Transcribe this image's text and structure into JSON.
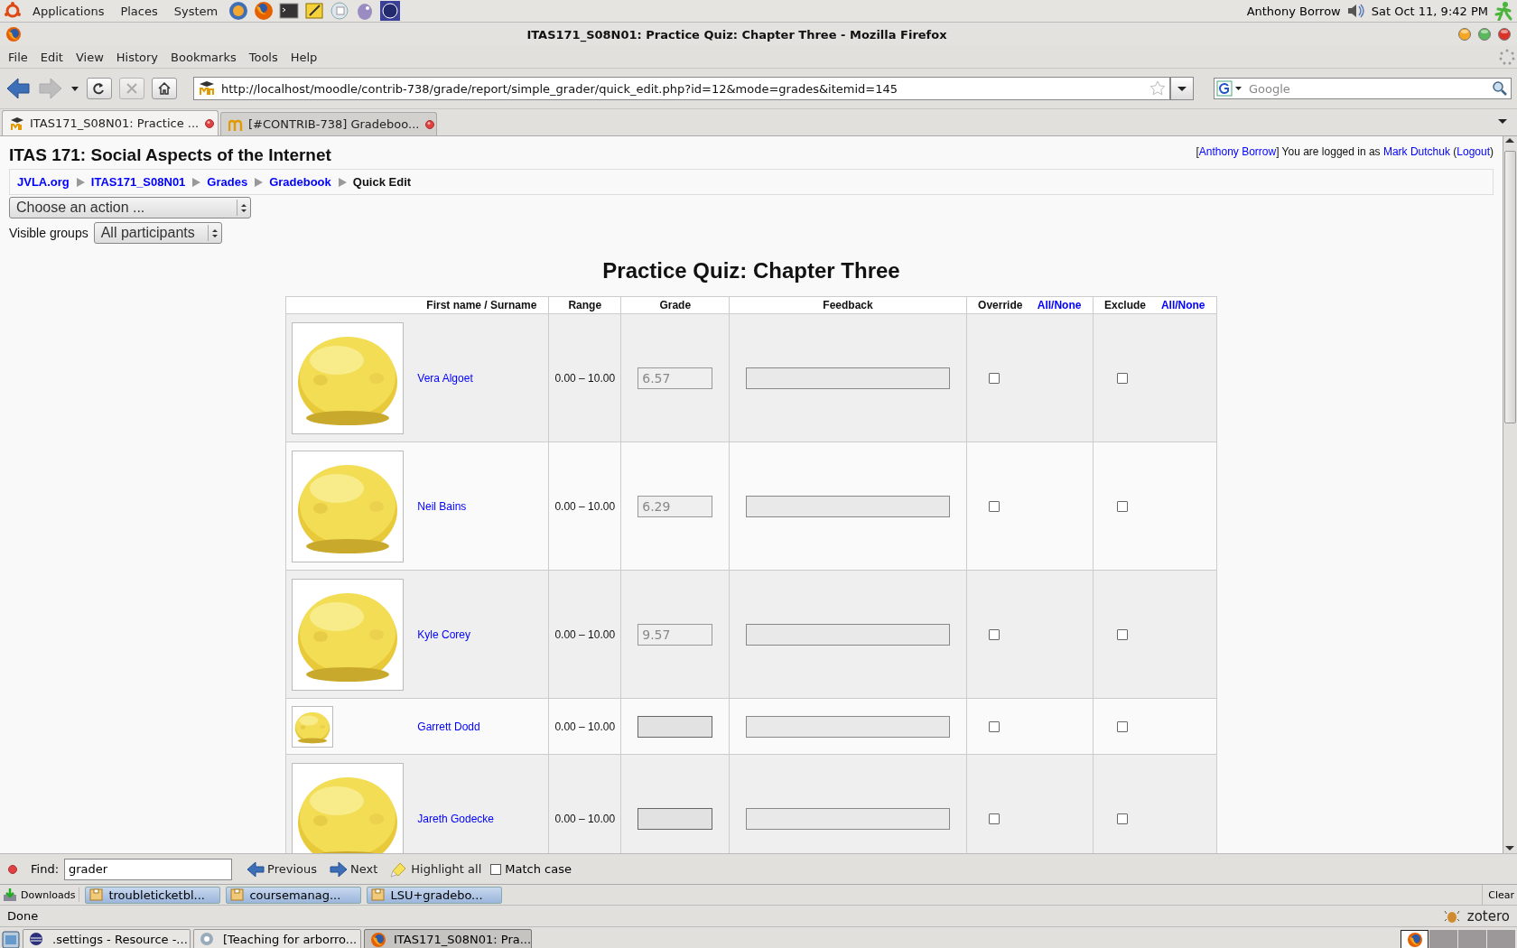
{
  "top_panel": {
    "menus": [
      "Applications",
      "Places",
      "System"
    ],
    "user": "Anthony Borrow",
    "clock": "Sat Oct 11,  9:42 PM"
  },
  "window": {
    "title": "ITAS171_S08N01: Practice Quiz: Chapter Three - Mozilla Firefox"
  },
  "menu_bar": [
    "File",
    "Edit",
    "View",
    "History",
    "Bookmarks",
    "Tools",
    "Help"
  ],
  "toolbar": {
    "url": "http://localhost/moodle/contrib-738/grade/report/simple_grader/quick_edit.php?id=12&mode=grades&itemid=145",
    "search_placeholder": "Google"
  },
  "tabs": [
    {
      "label": "ITAS171_S08N01: Practice ...",
      "selected": true
    },
    {
      "label": "[#CONTRIB-738] Gradeboo...",
      "selected": false
    }
  ],
  "page": {
    "course_title": "ITAS 171: Social Aspects of the Internet",
    "login": [
      {
        "kind": "text",
        "text": "["
      },
      {
        "kind": "link",
        "text": "Anthony Borrow"
      },
      {
        "kind": "text",
        "text": "] You are logged in as "
      },
      {
        "kind": "link",
        "text": "Mark Dutchuk"
      },
      {
        "kind": "text",
        "text": " ("
      },
      {
        "kind": "link",
        "text": "Logout"
      },
      {
        "kind": "text",
        "text": ")"
      }
    ],
    "breadcrumb": [
      {
        "label": "JVLA.org",
        "link": true
      },
      {
        "label": "ITAS171_S08N01",
        "link": true
      },
      {
        "label": "Grades",
        "link": true
      },
      {
        "label": "Gradebook",
        "link": true
      },
      {
        "label": "Quick Edit",
        "link": false
      }
    ],
    "action_select": "Choose an action ...",
    "groups": {
      "label": "Visible groups",
      "value": "All participants"
    },
    "heading": "Practice Quiz: Chapter Three",
    "columns": [
      {
        "label": "First name / Surname"
      },
      {
        "label": "Range"
      },
      {
        "label": "Grade"
      },
      {
        "label": "Feedback"
      },
      {
        "label": "Override",
        "link": "All/None"
      },
      {
        "label": "Exclude",
        "link": "All/None"
      }
    ],
    "rows": [
      {
        "name": "Vera Algoet",
        "range": "0.00 – 10.00",
        "grade": "6.57",
        "grade_disabled": true,
        "override": false,
        "exclude": false
      },
      {
        "name": "Neil Bains",
        "range": "0.00 – 10.00",
        "grade": "6.29",
        "grade_disabled": true,
        "override": false,
        "exclude": false
      },
      {
        "name": "Kyle Corey",
        "range": "0.00 – 10.00",
        "grade": "9.57",
        "grade_disabled": true,
        "override": false,
        "exclude": false
      },
      {
        "name": "Garrett Dodd",
        "range": "0.00 – 10.00",
        "grade_disabled": false,
        "override": false,
        "exclude": false,
        "kind": "thumbnail"
      },
      {
        "name": "Jareth Godecke",
        "range": "0.00 – 10.00",
        "grade_disabled": false,
        "override": false,
        "exclude": false
      }
    ]
  },
  "find_bar": {
    "label": "Find:",
    "value": "grader",
    "previous": "Previous",
    "next": "Next",
    "highlight": "Highlight all",
    "match_case": {
      "label": "Match case",
      "checked": false
    }
  },
  "downloads": {
    "label": "Downloads",
    "items": [
      "troubleticketbl...",
      "coursemanag...",
      "LSU+gradebo..."
    ],
    "clear": "Clear"
  },
  "status_bar": {
    "text": "Done",
    "zotero": "zotero"
  },
  "taskbar": [
    {
      "label": ".settings - Resource -...",
      "selected": false
    },
    {
      "label": "[Teaching for arborro...",
      "selected": false
    },
    {
      "label": "ITAS171_S08N01: Pra...",
      "selected": true
    }
  ]
}
